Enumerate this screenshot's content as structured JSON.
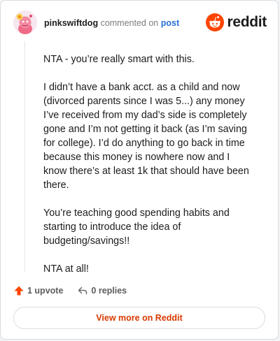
{
  "header": {
    "username": "pinkswiftdog",
    "action_text": "commented on",
    "post_link": "post",
    "logo_text": "reddit"
  },
  "comment": {
    "paragraphs": [
      "NTA - you’re really smart with this.",
      "I didn’t have a bank acct. as a child and now (divorced parents since I was 5...) any money I’ve received from my dad’s side is completely gone and I’m not getting it back (as I’m saving for college). I’d do anything to go back in time because this money is nowhere now and I know there’s at least 1k that should have been there.",
      "You’re teaching good spending habits and starting to introduce the idea of budgeting/savings!!",
      "NTA at all!"
    ]
  },
  "actions": {
    "upvote_label": "1 upvote",
    "replies_label": "0 replies"
  },
  "footer": {
    "view_more_label": "View more on Reddit"
  },
  "colors": {
    "reddit_orange": "#ff4500",
    "link_blue": "#2a6fd6",
    "view_more_text": "#d93a00"
  },
  "icons": {
    "avatar": "snoo-avatar-pink",
    "logo": "reddit-snoo-icon",
    "upvote": "upvote-arrow-icon",
    "reply": "reply-arrow-icon"
  }
}
